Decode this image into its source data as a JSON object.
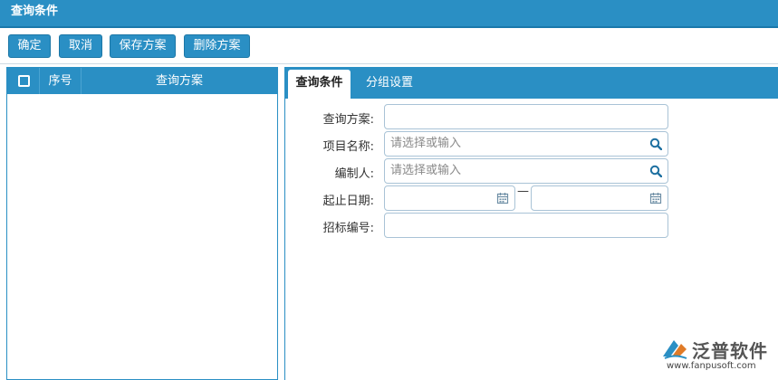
{
  "window": {
    "title": "查询条件"
  },
  "toolbar": {
    "confirm": "确定",
    "cancel": "取消",
    "save_plan": "保存方案",
    "delete_plan": "删除方案"
  },
  "grid": {
    "columns": [
      "序号",
      "查询方案"
    ]
  },
  "tabs": [
    {
      "label": "查询条件",
      "active": true
    },
    {
      "label": "分组设置",
      "active": false
    }
  ],
  "form": {
    "plan": {
      "label": "查询方案:",
      "value": ""
    },
    "project": {
      "label": "项目名称:",
      "placeholder": "请选择或输入"
    },
    "creator": {
      "label": "编制人:",
      "placeholder": "请选择或输入"
    },
    "date_range": {
      "label": "起止日期:",
      "start": "",
      "end": "",
      "separator": "—"
    },
    "bid_no": {
      "label": "招标编号:",
      "value": ""
    }
  },
  "branding": {
    "name": "泛普软件",
    "url": "www.fanpusoft.com"
  },
  "colors": {
    "primary": "#2a8fc4",
    "border": "#a9c3d6"
  }
}
